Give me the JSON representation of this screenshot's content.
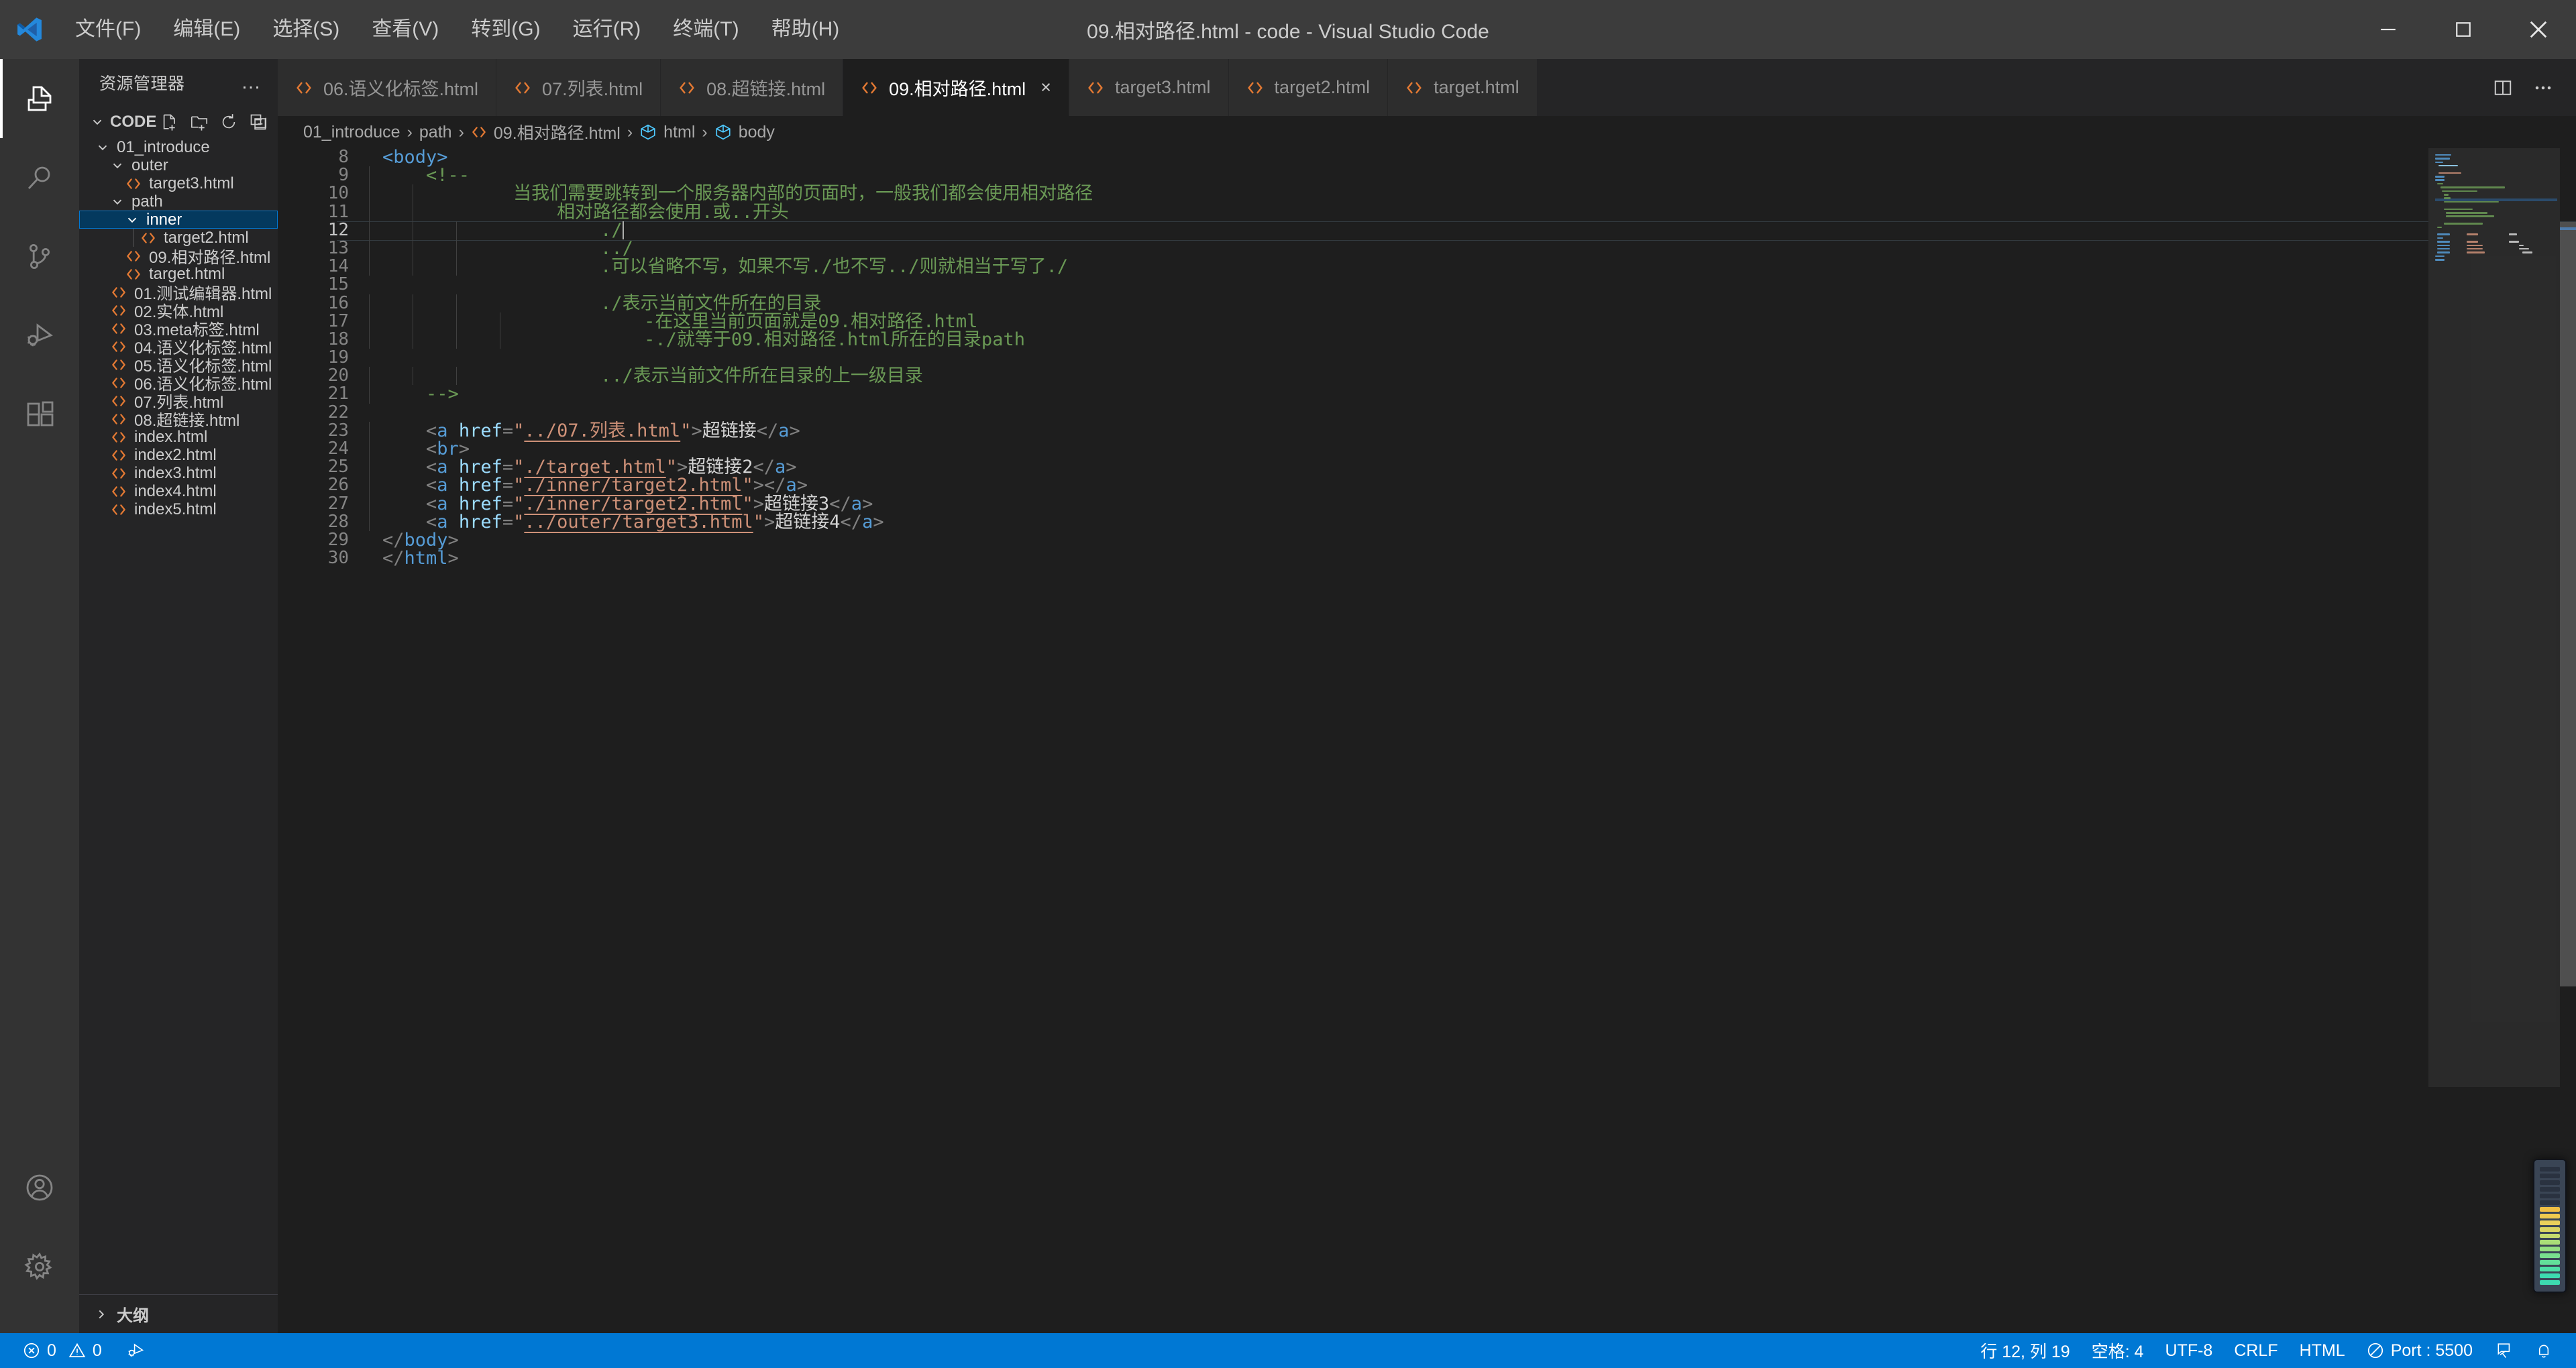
{
  "window": {
    "title": "09.相对路径.html - code - Visual Studio Code",
    "minimize_label": "最小化",
    "maximize_label": "最大化",
    "close_label": "关闭"
  },
  "menubar": [
    {
      "label": "文件(F)",
      "name": "menu-file"
    },
    {
      "label": "编辑(E)",
      "name": "menu-edit"
    },
    {
      "label": "选择(S)",
      "name": "menu-selection"
    },
    {
      "label": "查看(V)",
      "name": "menu-view"
    },
    {
      "label": "转到(G)",
      "name": "menu-go"
    },
    {
      "label": "运行(R)",
      "name": "menu-run"
    },
    {
      "label": "终端(T)",
      "name": "menu-terminal"
    },
    {
      "label": "帮助(H)",
      "name": "menu-help"
    }
  ],
  "activitybar": {
    "items": [
      {
        "icon": "explorer-icon",
        "label": "资源管理器",
        "active": true
      },
      {
        "icon": "search-icon",
        "label": "搜索",
        "active": false
      },
      {
        "icon": "source-control-icon",
        "label": "源代码管理",
        "active": false
      },
      {
        "icon": "run-debug-icon",
        "label": "运行和调试",
        "active": false
      },
      {
        "icon": "extensions-icon",
        "label": "扩展",
        "active": false
      }
    ],
    "bottom": [
      {
        "icon": "account-icon",
        "label": "帐户"
      },
      {
        "icon": "gear-icon",
        "label": "管理"
      }
    ]
  },
  "sidebar": {
    "title": "资源管理器",
    "more_label": "…",
    "root": {
      "label": "CODE",
      "actions": [
        {
          "icon": "new-file-icon",
          "label": "新建文件"
        },
        {
          "icon": "new-folder-icon",
          "label": "新建文件夹"
        },
        {
          "icon": "refresh-icon",
          "label": "在资源管理器中刷新"
        },
        {
          "icon": "collapse-all-icon",
          "label": "在资源管理器中折叠文件夹"
        }
      ]
    },
    "tree": [
      {
        "label": "01_introduce",
        "type": "folder",
        "depth": 1,
        "expanded": true,
        "selected": false
      },
      {
        "label": "outer",
        "type": "folder",
        "depth": 2,
        "expanded": true,
        "selected": false
      },
      {
        "label": "target3.html",
        "type": "file",
        "depth": 3,
        "expanded": false,
        "selected": false
      },
      {
        "label": "path",
        "type": "folder",
        "depth": 2,
        "expanded": true,
        "selected": false
      },
      {
        "label": "inner",
        "type": "folder",
        "depth": 3,
        "expanded": true,
        "selected": true
      },
      {
        "label": "target2.html",
        "type": "file",
        "depth": 4,
        "expanded": false,
        "selected": false
      },
      {
        "label": "09.相对路径.html",
        "type": "file",
        "depth": 3,
        "expanded": false,
        "selected": false
      },
      {
        "label": "target.html",
        "type": "file",
        "depth": 3,
        "expanded": false,
        "selected": false
      },
      {
        "label": "01.测试编辑器.html",
        "type": "file",
        "depth": 2,
        "expanded": false,
        "selected": false
      },
      {
        "label": "02.实体.html",
        "type": "file",
        "depth": 2,
        "expanded": false,
        "selected": false
      },
      {
        "label": "03.meta标签.html",
        "type": "file",
        "depth": 2,
        "expanded": false,
        "selected": false
      },
      {
        "label": "04.语义化标签.html",
        "type": "file",
        "depth": 2,
        "expanded": false,
        "selected": false
      },
      {
        "label": "05.语义化标签.html",
        "type": "file",
        "depth": 2,
        "expanded": false,
        "selected": false
      },
      {
        "label": "06.语义化标签.html",
        "type": "file",
        "depth": 2,
        "expanded": false,
        "selected": false
      },
      {
        "label": "07.列表.html",
        "type": "file",
        "depth": 2,
        "expanded": false,
        "selected": false
      },
      {
        "label": "08.超链接.html",
        "type": "file",
        "depth": 2,
        "expanded": false,
        "selected": false
      },
      {
        "label": "index.html",
        "type": "file",
        "depth": 2,
        "expanded": false,
        "selected": false
      },
      {
        "label": "index2.html",
        "type": "file",
        "depth": 2,
        "expanded": false,
        "selected": false
      },
      {
        "label": "index3.html",
        "type": "file",
        "depth": 2,
        "expanded": false,
        "selected": false
      },
      {
        "label": "index4.html",
        "type": "file",
        "depth": 2,
        "expanded": false,
        "selected": false
      },
      {
        "label": "index5.html",
        "type": "file",
        "depth": 2,
        "expanded": false,
        "selected": false
      }
    ],
    "outline": {
      "label": "大纲",
      "expanded": false
    }
  },
  "tabs": [
    {
      "label": "06.语义化标签.html",
      "active": false,
      "dirty": false
    },
    {
      "label": "07.列表.html",
      "active": false,
      "dirty": false
    },
    {
      "label": "08.超链接.html",
      "active": false,
      "dirty": false
    },
    {
      "label": "09.相对路径.html",
      "active": true,
      "dirty": false
    },
    {
      "label": "target3.html",
      "active": false,
      "dirty": false
    },
    {
      "label": "target2.html",
      "active": false,
      "dirty": false
    },
    {
      "label": "target.html",
      "active": false,
      "dirty": false
    }
  ],
  "tabbar_actions": [
    {
      "icon": "split-editor-icon",
      "label": "拆分编辑器"
    },
    {
      "icon": "more-actions-icon",
      "label": "更多操作..."
    }
  ],
  "breadcrumbs": [
    {
      "label": "01_introduce",
      "icon": ""
    },
    {
      "label": "path",
      "icon": ""
    },
    {
      "label": "09.相对路径.html",
      "icon": "html-icon"
    },
    {
      "label": "html",
      "icon": "symbol-field-icon"
    },
    {
      "label": "body",
      "icon": "symbol-field-icon"
    }
  ],
  "editor": {
    "first_line": 8,
    "current_line": 12,
    "close_tab_label": "×",
    "lines": [
      {
        "n": 8,
        "indents": [],
        "tokens": [
          {
            "t": "tag",
            "v": "<body>"
          }
        ]
      },
      {
        "n": 9,
        "indents": [
          0
        ],
        "tokens": [
          {
            "t": "cmt",
            "v": "    <!--"
          }
        ]
      },
      {
        "n": 10,
        "indents": [
          0,
          1
        ],
        "tokens": [
          {
            "t": "cmt",
            "v": "            当我们需要跳转到一个服务器内部的页面时，一般我们都会使用相对路径"
          }
        ]
      },
      {
        "n": 11,
        "indents": [
          0,
          1
        ],
        "tokens": [
          {
            "t": "cmt",
            "v": "                相对路径都会使用.或..开头"
          }
        ]
      },
      {
        "n": 12,
        "indents": [
          0,
          1,
          2
        ],
        "tokens": [
          {
            "t": "cmt",
            "v": "                    ./"
          }
        ]
      },
      {
        "n": 13,
        "indents": [
          0,
          1,
          2
        ],
        "tokens": [
          {
            "t": "cmt",
            "v": "                    ../"
          }
        ]
      },
      {
        "n": 14,
        "indents": [
          0,
          1,
          2
        ],
        "tokens": [
          {
            "t": "cmt",
            "v": "                    .可以省略不写，如果不写./也不写../则就相当于写了./"
          }
        ]
      },
      {
        "n": 15,
        "indents": [
          0,
          1,
          2
        ],
        "tokens": [
          {
            "t": "cmt",
            "v": ""
          }
        ]
      },
      {
        "n": 16,
        "indents": [
          0,
          1,
          2
        ],
        "tokens": [
          {
            "t": "cmt",
            "v": "                    ./表示当前文件所在的目录"
          }
        ]
      },
      {
        "n": 17,
        "indents": [
          0,
          1,
          2,
          3
        ],
        "tokens": [
          {
            "t": "cmt",
            "v": "                        -在这里当前页面就是09.相对路径.html"
          }
        ]
      },
      {
        "n": 18,
        "indents": [
          0,
          1,
          2,
          3
        ],
        "tokens": [
          {
            "t": "cmt",
            "v": "                        -./就等于09.相对路径.html所在的目录path"
          }
        ]
      },
      {
        "n": 19,
        "indents": [
          0,
          1,
          2,
          3
        ],
        "tokens": [
          {
            "t": "cmt",
            "v": ""
          }
        ]
      },
      {
        "n": 20,
        "indents": [
          0,
          1,
          2
        ],
        "tokens": [
          {
            "t": "cmt",
            "v": "                    ../表示当前文件所在目录的上一级目录"
          }
        ]
      },
      {
        "n": 21,
        "indents": [
          0
        ],
        "tokens": [
          {
            "t": "cmt",
            "v": "    -->"
          }
        ]
      },
      {
        "n": 22,
        "indents": [
          0
        ],
        "tokens": [
          {
            "t": "txt",
            "v": ""
          }
        ]
      },
      {
        "n": 23,
        "indents": [
          0
        ],
        "tokens": [
          {
            "t": "br",
            "v": "    <"
          },
          {
            "t": "tag",
            "v": "a"
          },
          {
            "t": "txt",
            "v": " "
          },
          {
            "t": "attr",
            "v": "href"
          },
          {
            "t": "br",
            "v": "="
          },
          {
            "t": "str",
            "v": "\""
          },
          {
            "t": "link",
            "v": "../07.列表.html"
          },
          {
            "t": "str",
            "v": "\""
          },
          {
            "t": "br",
            "v": ">"
          },
          {
            "t": "txt",
            "v": "超链接"
          },
          {
            "t": "br",
            "v": "</"
          },
          {
            "t": "tag",
            "v": "a"
          },
          {
            "t": "br",
            "v": ">"
          }
        ]
      },
      {
        "n": 24,
        "indents": [
          0
        ],
        "tokens": [
          {
            "t": "br",
            "v": "    <"
          },
          {
            "t": "tag",
            "v": "br"
          },
          {
            "t": "br",
            "v": ">"
          }
        ]
      },
      {
        "n": 25,
        "indents": [
          0
        ],
        "tokens": [
          {
            "t": "br",
            "v": "    <"
          },
          {
            "t": "tag",
            "v": "a"
          },
          {
            "t": "txt",
            "v": " "
          },
          {
            "t": "attr",
            "v": "href"
          },
          {
            "t": "br",
            "v": "="
          },
          {
            "t": "str",
            "v": "\""
          },
          {
            "t": "link",
            "v": "./target.html"
          },
          {
            "t": "str",
            "v": "\""
          },
          {
            "t": "br",
            "v": ">"
          },
          {
            "t": "txt",
            "v": "超链接2"
          },
          {
            "t": "br",
            "v": "</"
          },
          {
            "t": "tag",
            "v": "a"
          },
          {
            "t": "br",
            "v": ">"
          }
        ]
      },
      {
        "n": 26,
        "indents": [
          0
        ],
        "tokens": [
          {
            "t": "br",
            "v": "    <"
          },
          {
            "t": "tag",
            "v": "a"
          },
          {
            "t": "txt",
            "v": " "
          },
          {
            "t": "attr",
            "v": "href"
          },
          {
            "t": "br",
            "v": "="
          },
          {
            "t": "str",
            "v": "\""
          },
          {
            "t": "link",
            "v": "./inner/target2.html"
          },
          {
            "t": "str",
            "v": "\""
          },
          {
            "t": "br",
            "v": ">"
          },
          {
            "t": "br",
            "v": "</"
          },
          {
            "t": "tag",
            "v": "a"
          },
          {
            "t": "br",
            "v": ">"
          }
        ]
      },
      {
        "n": 27,
        "indents": [
          0
        ],
        "tokens": [
          {
            "t": "br",
            "v": "    <"
          },
          {
            "t": "tag",
            "v": "a"
          },
          {
            "t": "txt",
            "v": " "
          },
          {
            "t": "attr",
            "v": "href"
          },
          {
            "t": "br",
            "v": "="
          },
          {
            "t": "str",
            "v": "\""
          },
          {
            "t": "link",
            "v": "./inner/target2.html"
          },
          {
            "t": "str",
            "v": "\""
          },
          {
            "t": "br",
            "v": ">"
          },
          {
            "t": "txt",
            "v": "超链接3"
          },
          {
            "t": "br",
            "v": "</"
          },
          {
            "t": "tag",
            "v": "a"
          },
          {
            "t": "br",
            "v": ">"
          }
        ]
      },
      {
        "n": 28,
        "indents": [
          0
        ],
        "tokens": [
          {
            "t": "br",
            "v": "    <"
          },
          {
            "t": "tag",
            "v": "a"
          },
          {
            "t": "txt",
            "v": " "
          },
          {
            "t": "attr",
            "v": "href"
          },
          {
            "t": "br",
            "v": "="
          },
          {
            "t": "str",
            "v": "\""
          },
          {
            "t": "link",
            "v": "../outer/target3.html"
          },
          {
            "t": "str",
            "v": "\""
          },
          {
            "t": "br",
            "v": ">"
          },
          {
            "t": "txt",
            "v": "超链接4"
          },
          {
            "t": "br",
            "v": "</"
          },
          {
            "t": "tag",
            "v": "a"
          },
          {
            "t": "br",
            "v": ">"
          }
        ]
      },
      {
        "n": 29,
        "indents": [],
        "tokens": [
          {
            "t": "br",
            "v": "</"
          },
          {
            "t": "tag",
            "v": "body"
          },
          {
            "t": "br",
            "v": ">"
          }
        ]
      },
      {
        "n": 30,
        "indents": [],
        "tokens": [
          {
            "t": "br",
            "v": "</"
          },
          {
            "t": "tag",
            "v": "html"
          },
          {
            "t": "br",
            "v": ">"
          }
        ]
      }
    ]
  },
  "statusbar": {
    "left": [
      {
        "name": "problems",
        "icon": "error-icon",
        "text": "0",
        "icon2": "warning-icon",
        "text2": "0"
      },
      {
        "name": "live-share",
        "icon": "remote-debug-icon",
        "text": ""
      }
    ],
    "errors": "0",
    "warnings": "0",
    "right": [
      {
        "name": "cursor-position",
        "text": "行 12, 列 19"
      },
      {
        "name": "indentation",
        "text": "空格: 4"
      },
      {
        "name": "encoding",
        "text": "UTF-8"
      },
      {
        "name": "eol",
        "text": "CRLF"
      },
      {
        "name": "language-mode",
        "text": "HTML"
      },
      {
        "name": "live-server-port",
        "text": "Port : 5500",
        "icon": "broadcast-icon"
      },
      {
        "name": "feedback",
        "text": "",
        "icon": "feedback-icon"
      },
      {
        "name": "notifications",
        "text": "",
        "icon": "bell-icon"
      }
    ]
  },
  "colors": {
    "accent": "#0078d4",
    "titlebar_bg": "#3c3c3c",
    "sidebar_bg": "#252526",
    "editor_bg": "#1e1e1e",
    "activitybar_bg": "#333333",
    "selection_bg": "#04395e",
    "html_icon": "#e37933",
    "comment": "#6a9955",
    "tag": "#569cd6",
    "attribute": "#9cdcfe",
    "string": "#ce9178"
  }
}
